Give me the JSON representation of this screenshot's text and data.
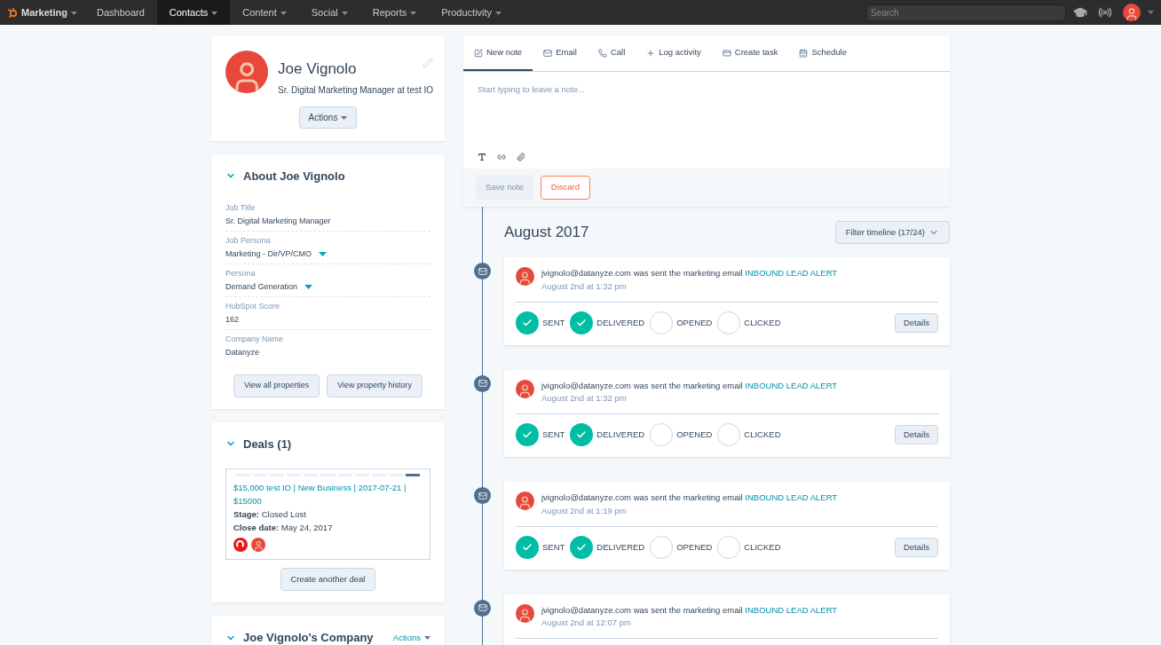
{
  "nav": {
    "brand": "Marketing",
    "items": [
      {
        "label": "Dashboard",
        "dropdown": false,
        "selected": false
      },
      {
        "label": "Contacts",
        "dropdown": true,
        "selected": true
      },
      {
        "label": "Content",
        "dropdown": true,
        "selected": false
      },
      {
        "label": "Social",
        "dropdown": true,
        "selected": false
      },
      {
        "label": "Reports",
        "dropdown": true,
        "selected": false
      },
      {
        "label": "Productivity",
        "dropdown": true,
        "selected": false
      }
    ],
    "search": {
      "placeholder": "Search"
    }
  },
  "profile": {
    "name": "Joe Vignolo",
    "subtitle": "Sr. Digital Marketing Manager at test IO",
    "actions": "Actions"
  },
  "about": {
    "title": "About Joe Vignolo",
    "expanded": true,
    "fields": [
      {
        "label": "Job Title",
        "value": "Sr. Digital Marketing Manager",
        "kind": "text"
      },
      {
        "label": "Job Persona",
        "value": "Marketing - Dir/VP/CMO",
        "kind": "select"
      },
      {
        "label": "Persona",
        "value": "Demand Generation",
        "kind": "select"
      },
      {
        "label": "HubSpot Score",
        "value": "162",
        "kind": "text"
      },
      {
        "label": "Company Name",
        "value": "Datanyze",
        "kind": "text"
      }
    ],
    "buttons": [
      "View all properties",
      "View property history"
    ]
  },
  "deals": {
    "title": "Deals (1)",
    "expanded": true,
    "deal": {
      "stages": [
        {
          "selected": false
        },
        {
          "selected": false
        },
        {
          "selected": false
        },
        {
          "selected": false
        },
        {
          "selected": false
        },
        {
          "selected": false
        },
        {
          "selected": false
        },
        {
          "selected": false
        },
        {
          "selected": false
        },
        {
          "selected": false
        },
        {
          "selected": true
        }
      ],
      "name": "$15,000 test IO | New Business | 2017-07-21 | $15000",
      "stage_label": "Stage:",
      "stage": "Closed Lost",
      "close_label": "Close date:",
      "close_date": "May 24, 2017"
    },
    "button": "Create another deal"
  },
  "company": {
    "title": "Joe Vignolo's Company",
    "expanded": true,
    "actions": "Actions"
  },
  "composer": {
    "tabs": [
      {
        "label": "New note",
        "selected": true
      },
      {
        "label": "Email",
        "selected": false
      },
      {
        "label": "Call",
        "selected": false
      },
      {
        "label": "Log activity",
        "selected": false
      },
      {
        "label": "Create task",
        "selected": false
      },
      {
        "label": "Schedule",
        "selected": false
      }
    ],
    "placeholder": "Start typing to leave a note...",
    "save": {
      "label": "Save note",
      "disabled": true
    },
    "discard": "Discard"
  },
  "timeline": {
    "month": "August 2017",
    "filter": "Filter timeline (17/24)",
    "events": [
      {
        "email": "jvignolo@datanyze.com",
        "text": "was sent the marketing email",
        "link": "INBOUND LEAD ALERT",
        "time": "August 2nd at 1:32 pm",
        "details": "Details",
        "statuses": [
          {
            "label": "SENT",
            "done": true
          },
          {
            "label": "DELIVERED",
            "done": true
          },
          {
            "label": "OPENED",
            "done": false
          },
          {
            "label": "CLICKED",
            "done": false
          }
        ]
      },
      {
        "email": "jvignolo@datanyze.com",
        "text": "was sent the marketing email",
        "link": "INBOUND LEAD ALERT",
        "time": "August 2nd at 1:32 pm",
        "details": "Details",
        "statuses": [
          {
            "label": "SENT",
            "done": true
          },
          {
            "label": "DELIVERED",
            "done": true
          },
          {
            "label": "OPENED",
            "done": false
          },
          {
            "label": "CLICKED",
            "done": false
          }
        ]
      },
      {
        "email": "jvignolo@datanyze.com",
        "text": "was sent the marketing email",
        "link": "INBOUND LEAD ALERT",
        "time": "August 2nd at 1:19 pm",
        "details": "Details",
        "statuses": [
          {
            "label": "SENT",
            "done": true
          },
          {
            "label": "DELIVERED",
            "done": true
          },
          {
            "label": "OPENED",
            "done": false
          },
          {
            "label": "CLICKED",
            "done": false
          }
        ]
      },
      {
        "email": "jvignolo@datanyze.com",
        "text": "was sent the marketing email",
        "link": "INBOUND LEAD ALERT",
        "time": "August 2nd at 12:07 pm"
      }
    ]
  }
}
